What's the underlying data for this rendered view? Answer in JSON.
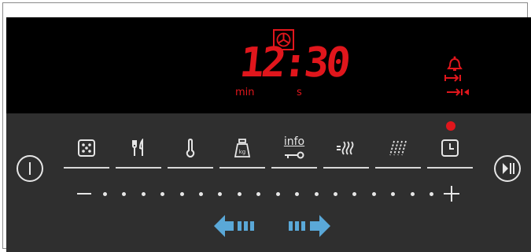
{
  "display": {
    "time": "12:30",
    "unit_min": "min",
    "unit_s": "s"
  },
  "programs": [
    {
      "name": "cooking-program",
      "icon": "dice-icon"
    },
    {
      "name": "meals",
      "icon": "cutlery-icon"
    },
    {
      "name": "temperature",
      "icon": "thermometer-icon"
    },
    {
      "name": "weight",
      "icon": "weight-kg-icon"
    },
    {
      "name": "info",
      "icon": "info-key-icon",
      "label": "info"
    },
    {
      "name": "steam",
      "icon": "steam-icon"
    },
    {
      "name": "grill",
      "icon": "grill-icon"
    },
    {
      "name": "timer",
      "icon": "clock-icon"
    }
  ],
  "slider": {
    "minus": "−",
    "plus": "+",
    "dots": 18
  },
  "colors": {
    "display_bg": "#000000",
    "panel_bg": "#2f2f2f",
    "digit_red": "#e0161c",
    "arrow_blue": "#5aa8d8",
    "icon_white": "#e6e6e6"
  }
}
